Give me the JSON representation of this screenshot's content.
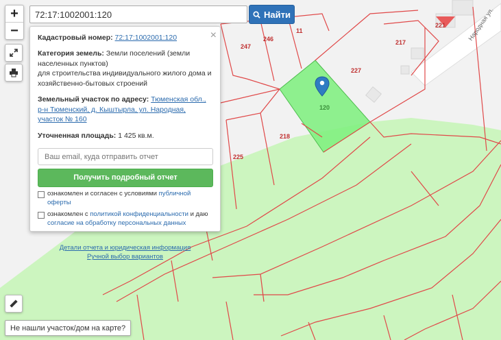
{
  "search": {
    "value": "72:17:1002001:120",
    "button_label": "Найти"
  },
  "zoom": {
    "in_label": "+",
    "out_label": "−"
  },
  "map": {
    "parcel_labels": [
      "246",
      "11",
      "247",
      "227",
      "217",
      "221",
      "218",
      "225",
      "120"
    ],
    "street_label": "Народная ул.",
    "highlight_color": "#7cf07c",
    "forest_color": "#ccf5bf",
    "boundary_color": "#e04848"
  },
  "panel": {
    "cadastral_label": "Кадастровый номер:",
    "cadastral_value": "72:17:1002001:120",
    "category_label": "Категория земель:",
    "category_value": "Земли поселений (земли населенных пунктов)",
    "category_purpose": "для строительства индивидуального жилого дома и хозяйственно-бытовых строений",
    "address_label": "Земельный участок по адресу:",
    "address_value": "Тюменская обл., р-н Тюменский, д. Кыштырла, ул. Народная, участок № 160",
    "area_label": "Уточненная площадь:",
    "area_value": "1 425 кв.м.",
    "email_placeholder": "Ваш email, куда отправить отчет",
    "report_button": "Получить подробный отчет",
    "consent1_text": "ознакомлен и согласен с условиями",
    "consent1_link": "публичной оферты",
    "consent2_text_a": "ознакомлен с",
    "consent2_link_a": "политикой конфиденциальности",
    "consent2_text_b": "и даю",
    "consent2_link_b": "согласие на обработку персональных данных",
    "details_link": "Детали отчета и юридическая информация",
    "manual_link": "Ручной выбор вариантов",
    "close_label": "×"
  },
  "not_found_label": "Не нашли участок/дом на карте?"
}
